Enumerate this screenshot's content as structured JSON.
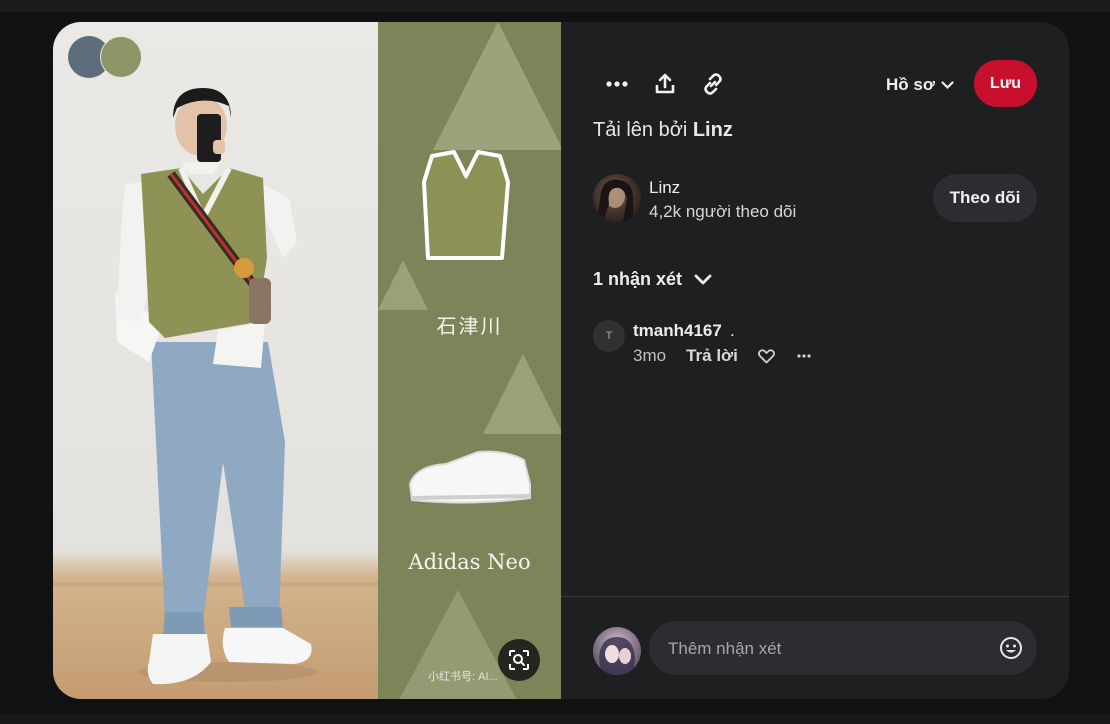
{
  "toolbar": {
    "more_icon": "more-horizontal-icon",
    "share_icon": "share-upload-icon",
    "link_icon": "link-icon",
    "profile_label": "Hồ sơ",
    "save_label": "Lưu"
  },
  "pin": {
    "uploaded_prefix": "Tải lên bởi",
    "uploaded_by": "Linz",
    "panel_caption": "石津川",
    "panel_brand": "Adidas Neo",
    "watermark": "小红书号: AI..."
  },
  "creator": {
    "name": "Linz",
    "followers": "4,2k người theo dõi",
    "follow_label": "Theo dõi"
  },
  "comments": {
    "header": "1 nhận xét",
    "items": [
      {
        "avatar_letter": "T",
        "user": "tmanh4167",
        "text": ".",
        "time": "3mo",
        "reply_label": "Trả lời"
      }
    ]
  },
  "composer": {
    "placeholder": "Thêm nhận xét"
  },
  "colors": {
    "save": "#c8102e",
    "background": "#1e1f21",
    "panel_green": "#7d8459"
  }
}
